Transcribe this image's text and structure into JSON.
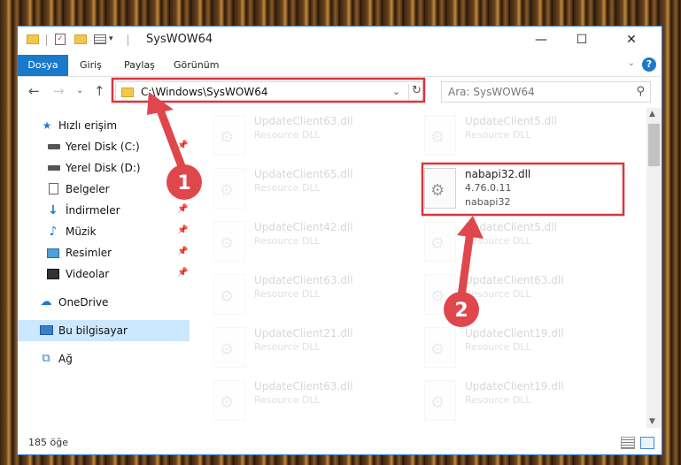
{
  "window": {
    "title": "SysWOW64",
    "minimize_glyph": "—",
    "maximize_glyph": "☐",
    "close_glyph": "✕"
  },
  "quick_access": {
    "check_glyph": "✓",
    "dropdown_glyph": "▾"
  },
  "ribbon": {
    "tabs": [
      "Dosya",
      "Giriş",
      "Paylaş",
      "Görünüm"
    ],
    "collapse_glyph": "⌄",
    "help_glyph": "?"
  },
  "navigation": {
    "back_glyph": "←",
    "forward_glyph": "→",
    "recent_glyph": "⌄",
    "up_glyph": "↑",
    "address": "C:\\Windows\\SysWOW64",
    "address_dropdown_glyph": "⌄",
    "refresh_glyph": "↻",
    "search_placeholder": "Ara: SysWOW64",
    "search_glyph": "⚲"
  },
  "sidebar": {
    "items": [
      {
        "label": "Hızlı erişim",
        "icon": "star-icon",
        "glyph": "★"
      },
      {
        "label": "Yerel Disk (C:)",
        "icon": "drive-icon",
        "glyph": ""
      },
      {
        "label": "Yerel Disk (D:)",
        "icon": "drive-icon",
        "glyph": ""
      },
      {
        "label": "Belgeler",
        "icon": "document-icon",
        "glyph": ""
      },
      {
        "label": "İndirmeler",
        "icon": "download-icon",
        "glyph": "↓"
      },
      {
        "label": "Müzik",
        "icon": "music-icon",
        "glyph": "♪"
      },
      {
        "label": "Resimler",
        "icon": "picture-icon",
        "glyph": ""
      },
      {
        "label": "Videolar",
        "icon": "video-icon",
        "glyph": ""
      },
      {
        "label": "OneDrive",
        "icon": "cloud-icon",
        "glyph": "☁"
      },
      {
        "label": "Bu bilgisayar",
        "icon": "computer-icon",
        "glyph": ""
      },
      {
        "label": "Ağ",
        "icon": "network-icon",
        "glyph": "⧉"
      }
    ],
    "pin_glyph": "📌"
  },
  "files": {
    "left_column": [
      {
        "name": "UpdateClient63.dll",
        "type": "Resource DLL"
      },
      {
        "name": "UpdateClient65.dll",
        "type": "Resource DLL"
      },
      {
        "name": "UpdateClient42.dll",
        "type": "Resource DLL"
      },
      {
        "name": "UpdateClient63.dll",
        "type": "Resource DLL"
      },
      {
        "name": "UpdateClient21.dll",
        "type": "Resource DLL"
      },
      {
        "name": "UpdateClient63.dll",
        "type": "Resource DLL"
      }
    ],
    "right_column": [
      {
        "name": "UpdateClient5.dll",
        "type": "Resource DLL"
      },
      {
        "name": "UpdateClient5.dll",
        "type": "Resource DLL"
      },
      {
        "name": "UpdateClient63.dll",
        "type": "Resource DLL"
      },
      {
        "name": "UpdateClient19.dll",
        "type": "Resource DLL"
      },
      {
        "name": "UpdateClient19.dll",
        "type": "Resource DLL"
      }
    ],
    "highlighted": {
      "name": "nabapi32.dll",
      "version": "4.76.0.11",
      "description": "nabapi32"
    },
    "gear_glyph": "⚙"
  },
  "scrollbar": {
    "up_glyph": "▲",
    "down_glyph": "▼"
  },
  "status": {
    "item_count": "185 öğe"
  },
  "annotations": {
    "step1": "1",
    "step2": "2",
    "highlight_color": "#d9363e",
    "arrow_color": "#e0474c"
  }
}
